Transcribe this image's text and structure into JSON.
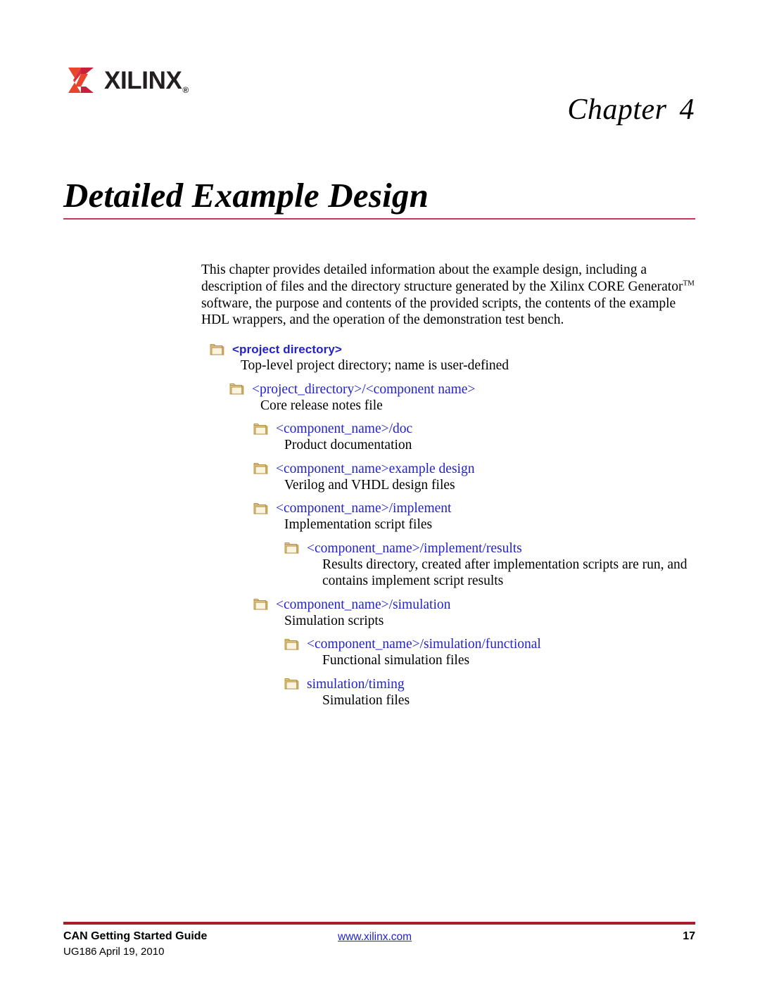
{
  "header": {
    "logo_text": "XILINX",
    "logo_registered": "®",
    "logo_icon": "xilinx-logo-mark",
    "chapter_word": "Chapter",
    "chapter_number": "4"
  },
  "title": {
    "text": "Detailed Example Design",
    "rule_color": "#c8365a"
  },
  "body": {
    "intro_part1": "This chapter provides detailed information about the example design, including a description of files and the directory structure generated by the Xilinx CORE Generator",
    "intro_trademark": "TM",
    "intro_part2": " software, the purpose and contents of the provided scripts, the contents of the example HDL wrappers, and the operation of the demonstration test bench."
  },
  "tree": {
    "icon_name": "folder-icon",
    "link_color": "#2222cc",
    "nodes": [
      {
        "label": "<project directory>",
        "desc": "Top-level project directory; name is user-defined",
        "level": 0,
        "bold": true
      },
      {
        "label": "<project_directory>/<component name>",
        "desc": "Core release notes file",
        "level": 1,
        "bold": false
      },
      {
        "label": "<component_name>/doc",
        "desc": "Product documentation",
        "level": 2,
        "bold": false
      },
      {
        "label": "<component_name>example design",
        "desc": "Verilog and VHDL design files",
        "level": 2,
        "bold": false
      },
      {
        "label": "<component_name>/implement",
        "desc": "Implementation script files",
        "level": 2,
        "bold": false
      },
      {
        "label": "<component_name>/implement/results",
        "desc": "Results directory, created after implementation scripts are run, and contains implement script results",
        "level": 3,
        "bold": false
      },
      {
        "label": "<component_name>/simulation",
        "desc": "Simulation scripts",
        "level": 2,
        "bold": false
      },
      {
        "label": "<component_name>/simulation/functional",
        "desc": "Functional simulation files",
        "level": 3,
        "bold": false
      },
      {
        "label": "simulation/timing",
        "desc": "Simulation files",
        "level": 3,
        "bold": false
      }
    ]
  },
  "footer": {
    "rule_color": "#a81e28",
    "guide_title": "CAN Getting Started Guide",
    "doc_id": "UG186 April 19, 2010",
    "url": "www.xilinx.com",
    "page_number": "17"
  }
}
